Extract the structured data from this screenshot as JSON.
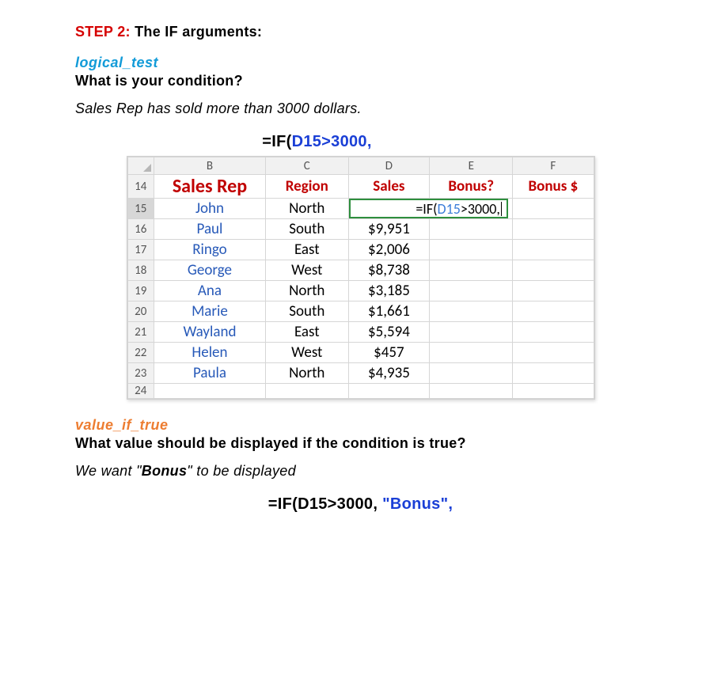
{
  "step": {
    "label": "STEP 2:",
    "rest": " The IF arguments:"
  },
  "arg1": {
    "name": "logical_test",
    "question": "What is your condition?",
    "answer": "Sales Rep has sold more than 3000 dollars.",
    "formula_prefix": "=IF(",
    "formula_hl": "D15>3000,"
  },
  "arg2": {
    "name": "value_if_true",
    "question": "What value should be displayed if the condition is true?",
    "answer_pre": "We want \"",
    "answer_bold": "Bonus",
    "answer_post": "\" to be displayed",
    "formula_prefix": "=IF(D15>3000, ",
    "formula_hl": "\"Bonus\","
  },
  "sheet": {
    "cols": [
      "B",
      "C",
      "D",
      "E",
      "F"
    ],
    "row_start": 14,
    "headers": {
      "B": "Sales Rep",
      "C": "Region",
      "D": "Sales",
      "E": "Bonus?",
      "F": "Bonus $"
    },
    "active_formula": {
      "pre": "=IF(",
      "ref": "D15",
      "post": ">3000,"
    },
    "rows": [
      {
        "n": 15,
        "rep": "John",
        "region": "North",
        "sales": ""
      },
      {
        "n": 16,
        "rep": "Paul",
        "region": "South",
        "sales": "$9,951"
      },
      {
        "n": 17,
        "rep": "Ringo",
        "region": "East",
        "sales": "$2,006"
      },
      {
        "n": 18,
        "rep": "George",
        "region": "West",
        "sales": "$8,738"
      },
      {
        "n": 19,
        "rep": "Ana",
        "region": "North",
        "sales": "$3,185"
      },
      {
        "n": 20,
        "rep": "Marie",
        "region": "South",
        "sales": "$1,661"
      },
      {
        "n": 21,
        "rep": "Wayland",
        "region": "East",
        "sales": "$5,594"
      },
      {
        "n": 22,
        "rep": "Helen",
        "region": "West",
        "sales": "$457"
      },
      {
        "n": 23,
        "rep": "Paula",
        "region": "North",
        "sales": "$4,935"
      }
    ],
    "trailing_row": 24
  }
}
